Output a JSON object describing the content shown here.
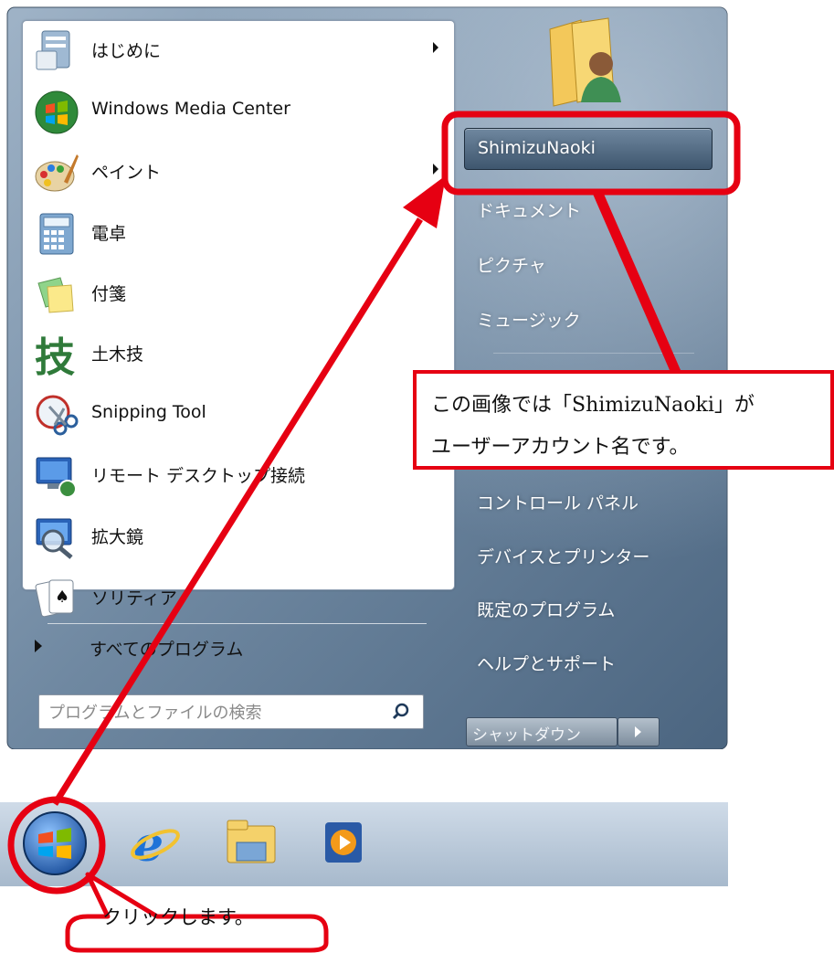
{
  "programs": [
    {
      "label": "はじめに",
      "icon": "getting-started-icon",
      "has_submenu": true
    },
    {
      "label": "Windows Media Center",
      "icon": "media-center-icon",
      "has_submenu": false
    },
    {
      "label": "ペイント",
      "icon": "paint-icon",
      "has_submenu": true
    },
    {
      "label": "電卓",
      "icon": "calculator-icon",
      "has_submenu": false
    },
    {
      "label": "付箋",
      "icon": "sticky-notes-icon",
      "has_submenu": false
    },
    {
      "label": "土木技",
      "icon": "dobokugi-icon",
      "has_submenu": false
    },
    {
      "label": "Snipping Tool",
      "icon": "snipping-tool-icon",
      "has_submenu": false
    },
    {
      "label": "リモート デスクトップ接続",
      "icon": "remote-desktop-icon",
      "has_submenu": false
    },
    {
      "label": "拡大鏡",
      "icon": "magnifier-icon",
      "has_submenu": false
    },
    {
      "label": "ソリティア",
      "icon": "solitaire-icon",
      "has_submenu": false
    }
  ],
  "all_programs": "すべてのプログラム",
  "search": {
    "placeholder": "プログラムとファイルの検索",
    "icon": "search-icon"
  },
  "right_items": {
    "user": "ShimizuNaoki",
    "documents": "ドキュメント",
    "pictures": "ピクチャ",
    "music": "ミュージック",
    "control_panel": "コントロール パネル",
    "devices": "デバイスとプリンター",
    "default_programs": "既定のプログラム",
    "help": "ヘルプとサポート"
  },
  "shutdown": "シャットダウン",
  "taskbar": [
    "start-orb-icon",
    "internet-explorer-icon",
    "explorer-icon",
    "media-player-icon"
  ],
  "callouts": {
    "account_line1": "この画像では「ShimizuNaoki」が",
    "account_line2": "ユーザーアカウント名です。",
    "click": "クリックします。"
  },
  "colors": {
    "annotation": "#e60012",
    "right_pane": "#4e6a86"
  }
}
